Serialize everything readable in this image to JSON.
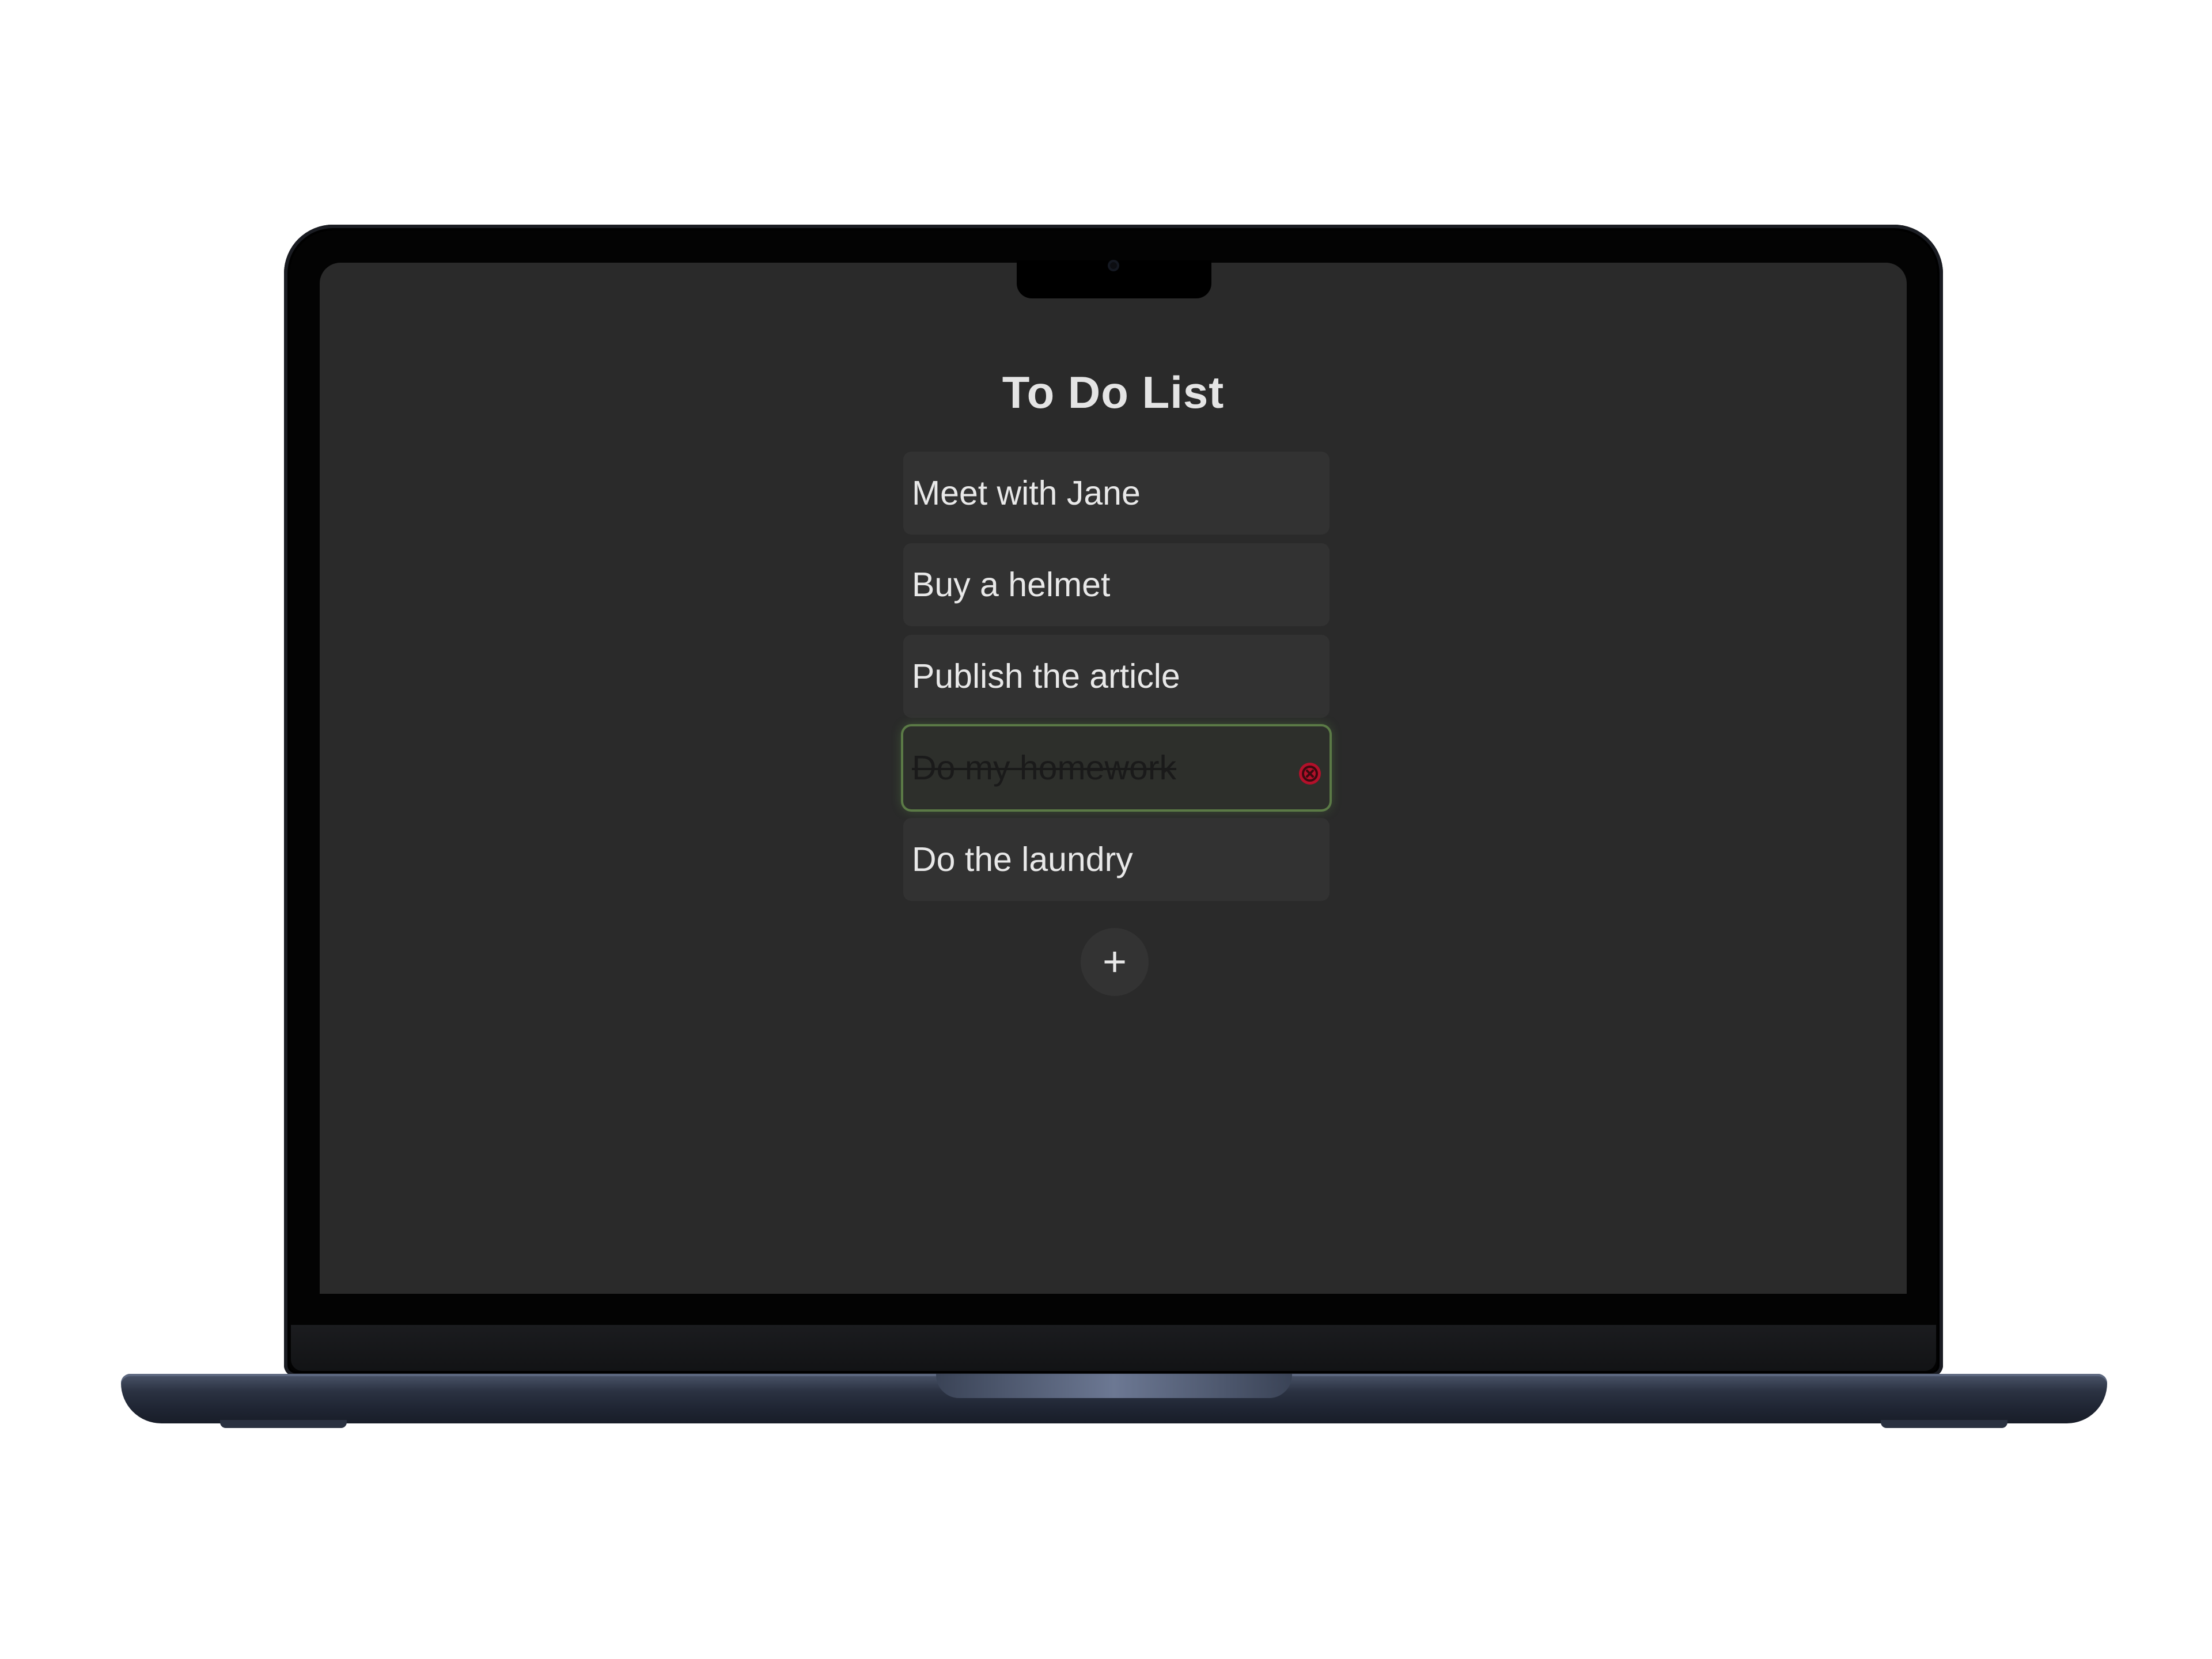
{
  "app": {
    "title": "To Do List"
  },
  "todos": [
    {
      "text": "Meet with Jane",
      "done": false
    },
    {
      "text": "Buy a helmet",
      "done": false
    },
    {
      "text": "Publish the article",
      "done": false
    },
    {
      "text": "Do my homework",
      "done": true
    },
    {
      "text": "Do the laundry",
      "done": false
    }
  ],
  "add_button": {
    "label": "+"
  },
  "icons": {
    "delete": "close-circle-icon",
    "add": "plus-icon"
  },
  "colors": {
    "screen_bg": "#2a2a2a",
    "item_bg": "#323232",
    "done_border": "#5b7a46",
    "delete_red": "#b3102a",
    "text": "#e8e8e8"
  }
}
